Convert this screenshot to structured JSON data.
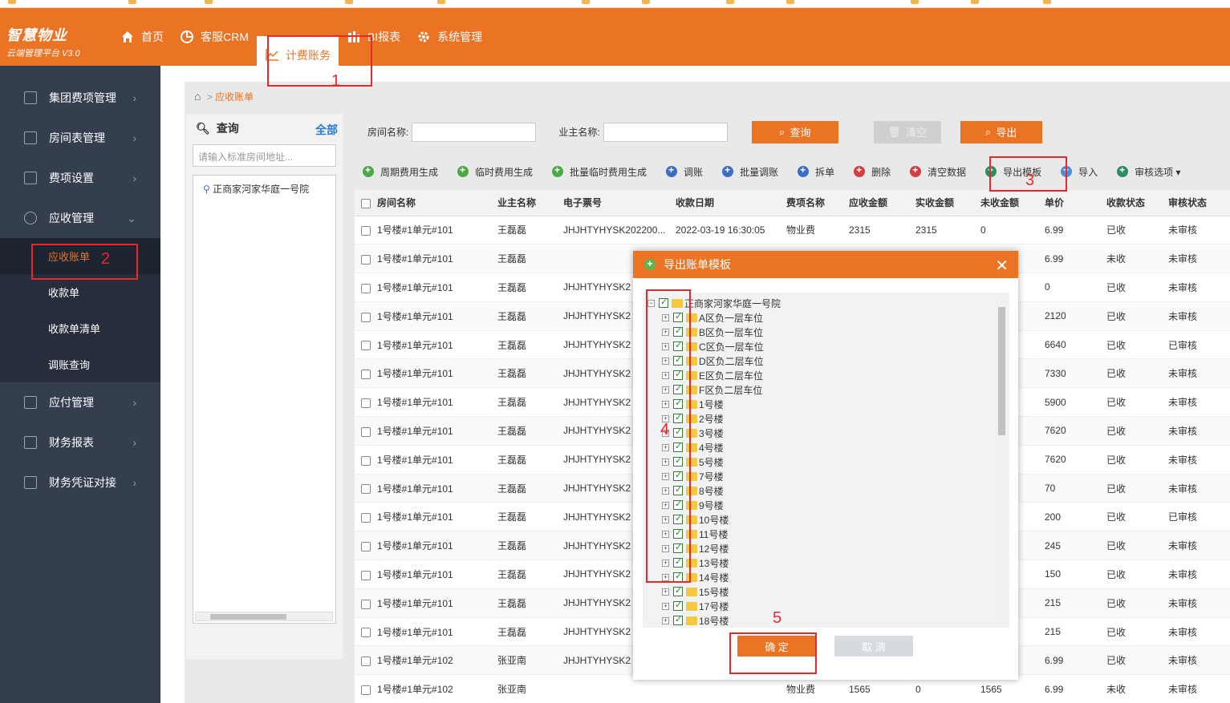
{
  "header": {
    "logo_line1": "智慧物业",
    "logo_line2": "云端管理平台 V3.0",
    "nav": [
      {
        "label": "首页",
        "icon": "home-icon"
      },
      {
        "label": "客服CRM",
        "icon": "pie-icon"
      },
      {
        "label": "计费账务",
        "icon": "line-chart-icon",
        "active": true
      },
      {
        "label": "BI报表",
        "icon": "bar-chart-icon"
      },
      {
        "label": "系统管理",
        "icon": "gear-icon"
      }
    ]
  },
  "sidebar": {
    "items": [
      {
        "label": "集团费项管理",
        "icon": "group-fee-icon"
      },
      {
        "label": "房间表管理",
        "icon": "room-table-icon"
      },
      {
        "label": "费项设置",
        "icon": "fee-setting-icon"
      },
      {
        "label": "应收管理",
        "icon": "receivable-icon",
        "expanded": true
      },
      {
        "label": "应付管理",
        "icon": "payable-icon"
      },
      {
        "label": "财务报表",
        "icon": "finance-report-icon"
      },
      {
        "label": "财务凭证对接",
        "icon": "voucher-icon"
      }
    ],
    "sub_items": [
      "应收账单",
      "收款单",
      "收款单清单",
      "调账查询"
    ]
  },
  "breadcrumb": {
    "current": "应收账单"
  },
  "left_panel": {
    "title": "查询",
    "all_link": "全部",
    "search_placeholder": "请输入标准房间地址...",
    "tree_root": "正商家河家华庭一号院"
  },
  "filter": {
    "room_label": "房间名称:",
    "owner_label": "业主名称:",
    "query_btn": "查询",
    "clear_btn": "清空",
    "export_btn": "导出"
  },
  "toolbar": [
    {
      "label": "周期费用生成",
      "color": "green"
    },
    {
      "label": "临时费用生成",
      "color": "green"
    },
    {
      "label": "批量临时费用生成",
      "color": "green"
    },
    {
      "label": "调账",
      "color": "blue"
    },
    {
      "label": "批量调账",
      "color": "blue"
    },
    {
      "label": "拆单",
      "color": "blue"
    },
    {
      "label": "删除",
      "color": "red"
    },
    {
      "label": "清空数据",
      "color": "red"
    },
    {
      "label": "导出模板",
      "color": "teal"
    },
    {
      "label": "导入",
      "color": "lblue"
    },
    {
      "label": "审核选项 ▾",
      "color": "teal"
    }
  ],
  "table": {
    "columns": [
      "房间名称",
      "业主名称",
      "电子票号",
      "收款日期",
      "费项名称",
      "应收金额",
      "实收金额",
      "未收金额",
      "单价",
      "收款状态",
      "审核状态"
    ],
    "rows": [
      [
        "1号楼#1单元#101",
        "王磊磊",
        "JHJHTYHYSK202200...",
        "2022-03-19 16:30:05",
        "物业费",
        "2315",
        "2315",
        "0",
        "6.99",
        "已收",
        "未审核"
      ],
      [
        "1号楼#1单元#101",
        "王磊磊",
        "",
        "",
        "",
        "",
        "",
        "",
        "6.99",
        "未收",
        "未审核"
      ],
      [
        "1号楼#1单元#101",
        "王磊磊",
        "JHJHTYHYSK2",
        "",
        "",
        "",
        "",
        "",
        "0",
        "已收",
        "未审核"
      ],
      [
        "1号楼#1单元#101",
        "王磊磊",
        "JHJHTYHYSK2",
        "",
        "",
        "",
        "",
        "",
        "2120",
        "已收",
        "未审核"
      ],
      [
        "1号楼#1单元#101",
        "王磊磊",
        "JHJHTYHYSK2",
        "",
        "",
        "",
        "",
        "",
        "6640",
        "已收",
        "已审核"
      ],
      [
        "1号楼#1单元#101",
        "王磊磊",
        "JHJHTYHYSK2",
        "",
        "",
        "",
        "",
        "",
        "7330",
        "已收",
        "未审核"
      ],
      [
        "1号楼#1单元#101",
        "王磊磊",
        "JHJHTYHYSK2",
        "",
        "",
        "",
        "",
        "",
        "5900",
        "已收",
        "未审核"
      ],
      [
        "1号楼#1单元#101",
        "王磊磊",
        "JHJHTYHYSK2",
        "",
        "",
        "",
        "",
        "",
        "7620",
        "已收",
        "未审核"
      ],
      [
        "1号楼#1单元#101",
        "王磊磊",
        "JHJHTYHYSK2",
        "",
        "",
        "",
        "",
        "",
        "7620",
        "已收",
        "未审核"
      ],
      [
        "1号楼#1单元#101",
        "王磊磊",
        "JHJHTYHYSK2",
        "",
        "",
        "",
        "",
        "",
        "70",
        "已收",
        "未审核"
      ],
      [
        "1号楼#1单元#101",
        "王磊磊",
        "JHJHTYHYSK2",
        "",
        "",
        "",
        "",
        "",
        "200",
        "已收",
        "已审核"
      ],
      [
        "1号楼#1单元#101",
        "王磊磊",
        "JHJHTYHYSK2",
        "",
        "",
        "",
        "",
        "",
        "245",
        "已收",
        "未审核"
      ],
      [
        "1号楼#1单元#101",
        "王磊磊",
        "JHJHTYHYSK2",
        "",
        "",
        "",
        "",
        "",
        "150",
        "已收",
        "未审核"
      ],
      [
        "1号楼#1单元#101",
        "王磊磊",
        "JHJHTYHYSK2",
        "",
        "",
        "",
        "",
        "",
        "215",
        "已收",
        "未审核"
      ],
      [
        "1号楼#1单元#101",
        "王磊磊",
        "JHJHTYHYSK2",
        "",
        "",
        "",
        "",
        "",
        "215",
        "已收",
        "未审核"
      ],
      [
        "1号楼#1单元#102",
        "张亚南",
        "JHJHTYHYSK2",
        "",
        "",
        "",
        "",
        "",
        "6.99",
        "已收",
        "未审核"
      ],
      [
        "1号楼#1单元#102",
        "张亚南",
        "",
        "",
        "物业费",
        "1565",
        "0",
        "1565",
        "6.99",
        "未收",
        "未审核"
      ]
    ]
  },
  "modal": {
    "title": "导出账单模板",
    "close": "✕",
    "root": "正商家河家华庭一号院",
    "nodes": [
      "A区负一层车位",
      "B区负一层车位",
      "C区负一层车位",
      "D区负二层车位",
      "E区负二层车位",
      "F区负二层车位",
      "1号楼",
      "2号楼",
      "3号楼",
      "4号楼",
      "5号楼",
      "7号楼",
      "8号楼",
      "9号楼",
      "10号楼",
      "11号楼",
      "12号楼",
      "13号楼",
      "14号楼",
      "15号楼",
      "17号楼",
      "18号楼"
    ],
    "ok": "确  定",
    "cancel": "取  消"
  },
  "annotations": [
    "1",
    "2",
    "3",
    "4",
    "5"
  ]
}
